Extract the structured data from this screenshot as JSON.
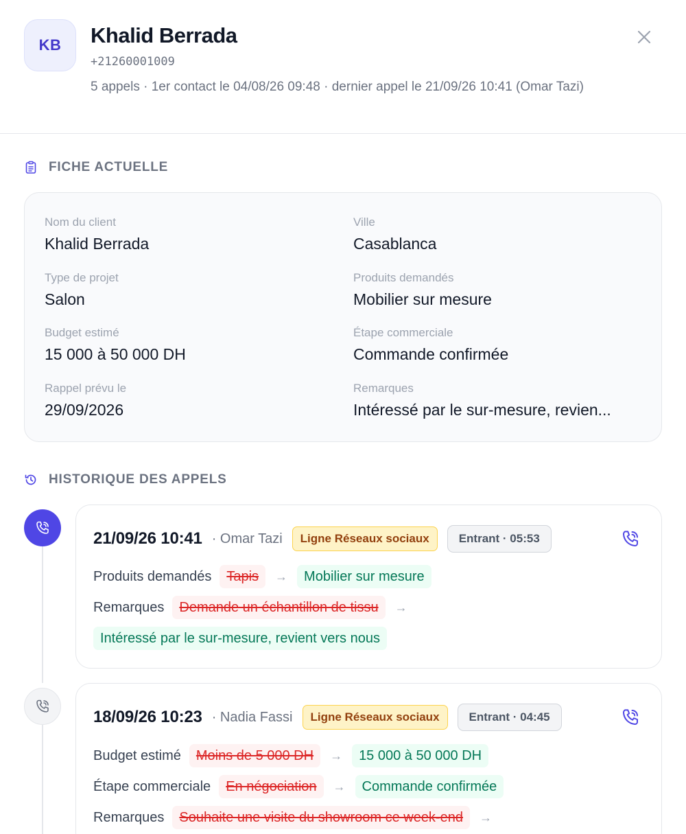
{
  "header": {
    "initials": "KB",
    "name": "Khalid Berrada",
    "phone": "+21260001009",
    "summary": "5 appels · 1er contact le 04/08/26 09:48 · dernier appel le 21/09/26 10:41 (Omar Tazi)"
  },
  "fiche": {
    "title": "FICHE ACTUELLE",
    "fields": [
      {
        "label": "Nom du client",
        "value": "Khalid Berrada"
      },
      {
        "label": "Ville",
        "value": "Casablanca"
      },
      {
        "label": "Type de projet",
        "value": "Salon"
      },
      {
        "label": "Produits demandés",
        "value": "Mobilier sur mesure"
      },
      {
        "label": "Budget estimé",
        "value": "15 000 à 50 000 DH"
      },
      {
        "label": "Étape commerciale",
        "value": "Commande confirmée"
      },
      {
        "label": "Rappel prévu le",
        "value": "29/09/2026"
      },
      {
        "label": "Remarques",
        "value": "Intéressé par le sur-mesure, revien..."
      }
    ]
  },
  "history": {
    "title": "HISTORIQUE DES APPELS",
    "calls": [
      {
        "datetime": "21/09/26 10:41",
        "agent": "· Omar Tazi",
        "line": "Ligne Réseaux sociaux",
        "direction": "Entrant · 05:53",
        "changes": [
          {
            "label": "Produits demandés",
            "old": "Tapis",
            "new": "Mobilier sur mesure"
          },
          {
            "label": "Remarques",
            "old": "Demande un échantillon de tissu",
            "new": "Intéressé par le sur-mesure, revient vers nous"
          }
        ]
      },
      {
        "datetime": "18/09/26 10:23",
        "agent": "· Nadia Fassi",
        "line": "Ligne Réseaux sociaux",
        "direction": "Entrant · 04:45",
        "changes": [
          {
            "label": "Budget estimé",
            "old": "Moins de 5 000 DH",
            "new": "15 000 à 50 000 DH"
          },
          {
            "label": "Étape commerciale",
            "old": "En négociation",
            "new": "Commande confirmée"
          },
          {
            "label": "Remarques",
            "old": "Souhaite une visite du showroom ce week-end",
            "new": ""
          }
        ]
      }
    ]
  },
  "colors": {
    "accent": "#4f46e5",
    "old": "#dc2626",
    "new": "#047857",
    "line_badge": "#fef3c7"
  },
  "icons": {
    "close": "close-icon",
    "fiche": "clipboard-icon",
    "history": "history-icon",
    "call": "phone-call-icon"
  }
}
